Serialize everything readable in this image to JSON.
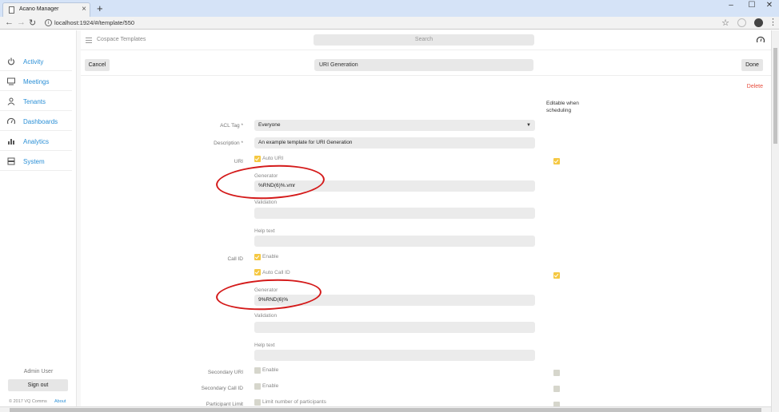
{
  "browser": {
    "tab_title": "Acano Manager",
    "url": "localhost:1924/#/template/550"
  },
  "sidebar": {
    "items": [
      {
        "label": "Activity",
        "icon": "power-icon"
      },
      {
        "label": "Meetings",
        "icon": "monitor-icon"
      },
      {
        "label": "Tenants",
        "icon": "user-icon"
      },
      {
        "label": "Dashboards",
        "icon": "gauge-icon"
      },
      {
        "label": "Analytics",
        "icon": "bar-chart-icon"
      },
      {
        "label": "System",
        "icon": "server-icon"
      }
    ],
    "admin_user": "Admin User",
    "sign_out": "Sign out",
    "copyright": "© 2017 VQ Comms",
    "about": "About"
  },
  "topbar": {
    "section": "Cospace Templates",
    "search_placeholder": "Search"
  },
  "editor": {
    "cancel": "Cancel",
    "template_name": "URI Generation",
    "done": "Done",
    "delete": "Delete",
    "editable_header": "Editable when scheduling"
  },
  "form": {
    "acl_tag_label": "ACL Tag *",
    "acl_tag_value": "Everyone",
    "description_label": "Description *",
    "description_value": "An example template for URI Generation",
    "uri_label": "URI",
    "auto_uri": "Auto URI",
    "uri_generator_label": "Generator",
    "uri_generator_value": "%RND(6)%.vmr",
    "uri_validation_label": "Validation",
    "uri_help_label": "Help text",
    "callid_label": "Call ID",
    "callid_enable": "Enable",
    "auto_callid": "Auto Call ID",
    "callid_generator_label": "Generator",
    "callid_generator_value": "9%RND(6)%",
    "callid_validation_label": "Validation",
    "callid_help_label": "Help text",
    "secondary_uri_label": "Secondary URI",
    "secondary_uri_enable": "Enable",
    "secondary_callid_label": "Secondary Call ID",
    "secondary_callid_enable": "Enable",
    "participant_limit_label": "Participant Limit",
    "participant_limit_option": "Limit number of participants"
  },
  "colors": {
    "accent": "#2a8fd6",
    "checkbox_on": "#f5c842",
    "annotation": "#d41a1a",
    "delete": "#e74c3c"
  }
}
